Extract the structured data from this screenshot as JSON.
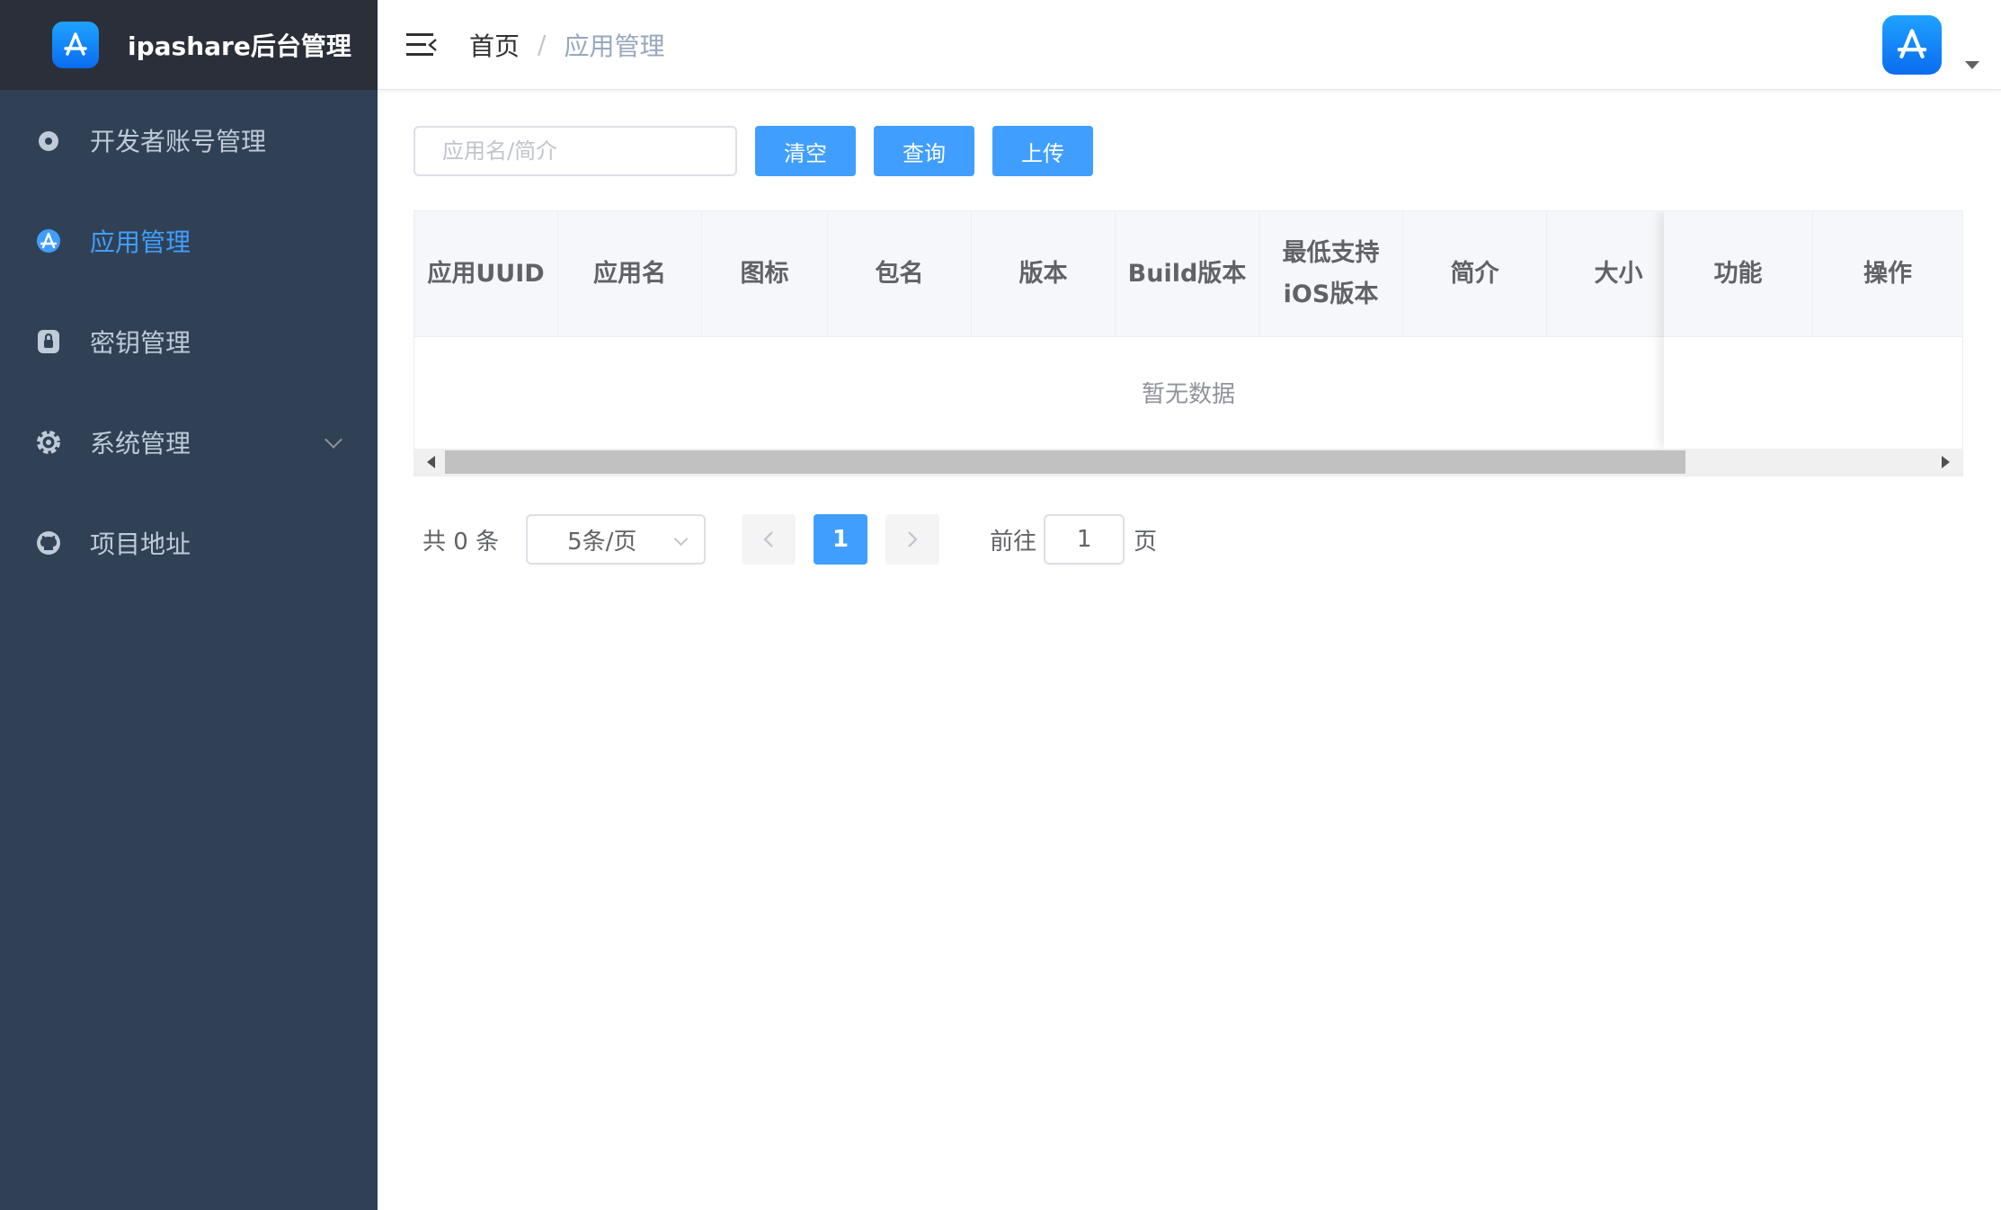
{
  "app": {
    "title": "ipashare后台管理",
    "logo_icon": "app-store-icon"
  },
  "sidebar": {
    "items": [
      {
        "label": "开发者账号管理",
        "icon": "apple-icon",
        "active": false
      },
      {
        "label": "应用管理",
        "icon": "app-store-icon",
        "active": true
      },
      {
        "label": "密钥管理",
        "icon": "lock-icon",
        "active": false
      },
      {
        "label": "系统管理",
        "icon": "gear-icon",
        "active": false,
        "expandable": true
      },
      {
        "label": "项目地址",
        "icon": "github-icon",
        "active": false
      }
    ]
  },
  "header": {
    "breadcrumb": {
      "home": "首页",
      "separator": "/",
      "current": "应用管理"
    },
    "avatar_icon": "app-store-icon"
  },
  "filter": {
    "search_placeholder": "应用名/简介",
    "clear_label": "清空",
    "query_label": "查询",
    "upload_label": "上传"
  },
  "table": {
    "columns": [
      "应用UUID",
      "应用名",
      "图标",
      "包名",
      "版本",
      "Build版本",
      "最低支持iOS版本",
      "简介",
      "大小",
      "功能",
      "操作"
    ],
    "rows": [],
    "empty_text": "暂无数据"
  },
  "pagination": {
    "total_label": "共 0 条",
    "page_size": "5条/页",
    "current_page": "1",
    "goto_prefix": "前往",
    "goto_value": "1",
    "goto_suffix": "页"
  },
  "colors": {
    "sidebar_bg": "#304156",
    "sidebar_header_bg": "#2b2f3a",
    "accent": "#409eff",
    "sidebar_text": "#bfcbd9"
  }
}
